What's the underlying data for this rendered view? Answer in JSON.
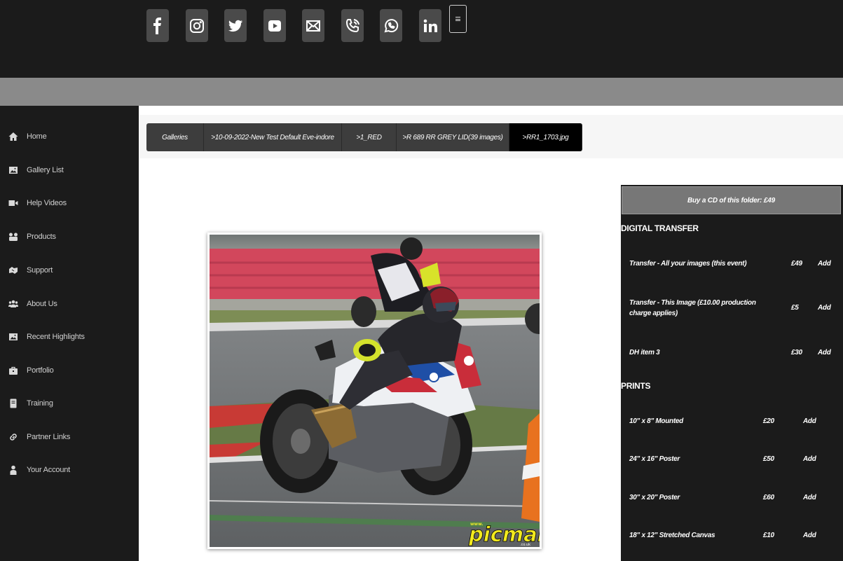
{
  "social_icons": [
    {
      "icon": "facebook-icon"
    },
    {
      "icon": "instagram-icon"
    },
    {
      "icon": "twitter-icon"
    },
    {
      "icon": "youtube-icon"
    },
    {
      "icon": "email-icon"
    },
    {
      "icon": "phone-icon"
    },
    {
      "icon": "whatsapp-icon"
    },
    {
      "icon": "linkedin-icon"
    }
  ],
  "sidebar": {
    "items": [
      {
        "label": "Home",
        "icon": "home-icon"
      },
      {
        "label": "Gallery List",
        "icon": "image-icon"
      },
      {
        "label": "Help Videos",
        "icon": "video-camera-icon"
      },
      {
        "label": "Products",
        "icon": "products-icon"
      },
      {
        "label": "Support",
        "icon": "support-icon"
      },
      {
        "label": "About Us",
        "icon": "users-icon"
      },
      {
        "label": "Recent Highlights",
        "icon": "image-icon"
      },
      {
        "label": "Portfolio",
        "icon": "briefcase-icon"
      },
      {
        "label": "Training",
        "icon": "book-icon"
      },
      {
        "label": "Partner Links",
        "icon": "link-icon"
      },
      {
        "label": "Your Account",
        "icon": "user-icon"
      }
    ]
  },
  "breadcrumb": [
    {
      "label": "Galleries"
    },
    {
      "label": ">10-09-2022-New Test Default Eve-indore"
    },
    {
      "label": ">1_RED"
    },
    {
      "label": ">R 689 RR GREY LID(39 images)"
    },
    {
      "label": ">RR1_1703.jpg"
    }
  ],
  "photo": {
    "watermark_small": "www.",
    "watermark": "picman",
    "watermark_sub": ".co.uk"
  },
  "panel": {
    "cd_button": "Buy a CD of this folder: £49",
    "digital_title": "DIGITAL TRANSFER",
    "digital_items": [
      {
        "name": "Transfer - All your images (this event)",
        "price": "£49",
        "action": "Add"
      },
      {
        "name": "Transfer - This Image (£10.00 production charge applies)",
        "price": "£5",
        "action": "Add"
      },
      {
        "name": "DH item 3",
        "price": "£30",
        "action": "Add"
      }
    ],
    "prints_title": "PRINTS",
    "print_items": [
      {
        "name": "10\" x 8\" Mounted",
        "price": "£20",
        "action": "Add"
      },
      {
        "name": "24\" x 16\" Poster",
        "price": "£50",
        "action": "Add"
      },
      {
        "name": "30\" x 20\" Poster",
        "price": "£60",
        "action": "Add"
      },
      {
        "name": "18\" x 12\" Stretched Canvas",
        "price": "£10",
        "action": "Add"
      }
    ]
  }
}
